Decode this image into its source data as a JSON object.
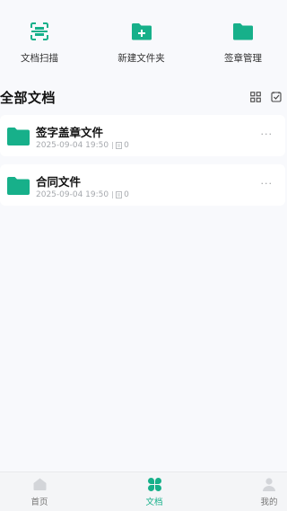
{
  "colors": {
    "accent": "#17b08a",
    "inactive": "#c9cbcf",
    "text": "#111111"
  },
  "quick_actions": [
    {
      "label": "文档扫描",
      "icon": "scan-icon"
    },
    {
      "label": "新建文件夹",
      "icon": "folder-plus-icon"
    },
    {
      "label": "签章管理",
      "icon": "folder-icon"
    }
  ],
  "section": {
    "title": "全部文档"
  },
  "files": [
    {
      "name": "签字盖章文件",
      "date": "2025-09-04 19:50",
      "count": "0"
    },
    {
      "name": "合同文件",
      "date": "2025-09-04 19:50",
      "count": "0"
    }
  ],
  "more_glyph": "···",
  "nav": [
    {
      "label": "首页",
      "icon": "home-icon",
      "active": false
    },
    {
      "label": "文档",
      "icon": "clover-icon",
      "active": true
    },
    {
      "label": "我的",
      "icon": "user-icon",
      "active": false
    }
  ]
}
